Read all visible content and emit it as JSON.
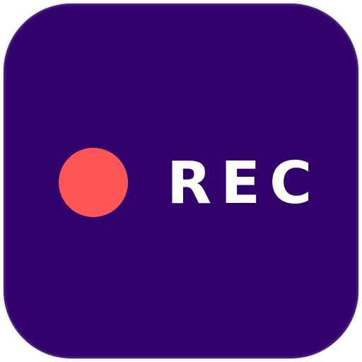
{
  "icon": {
    "label": "REC",
    "background_color": "#32006b",
    "dot_color": "#ff5556",
    "label_color": "#ffffff",
    "dot_icon": "record-dot-icon"
  }
}
